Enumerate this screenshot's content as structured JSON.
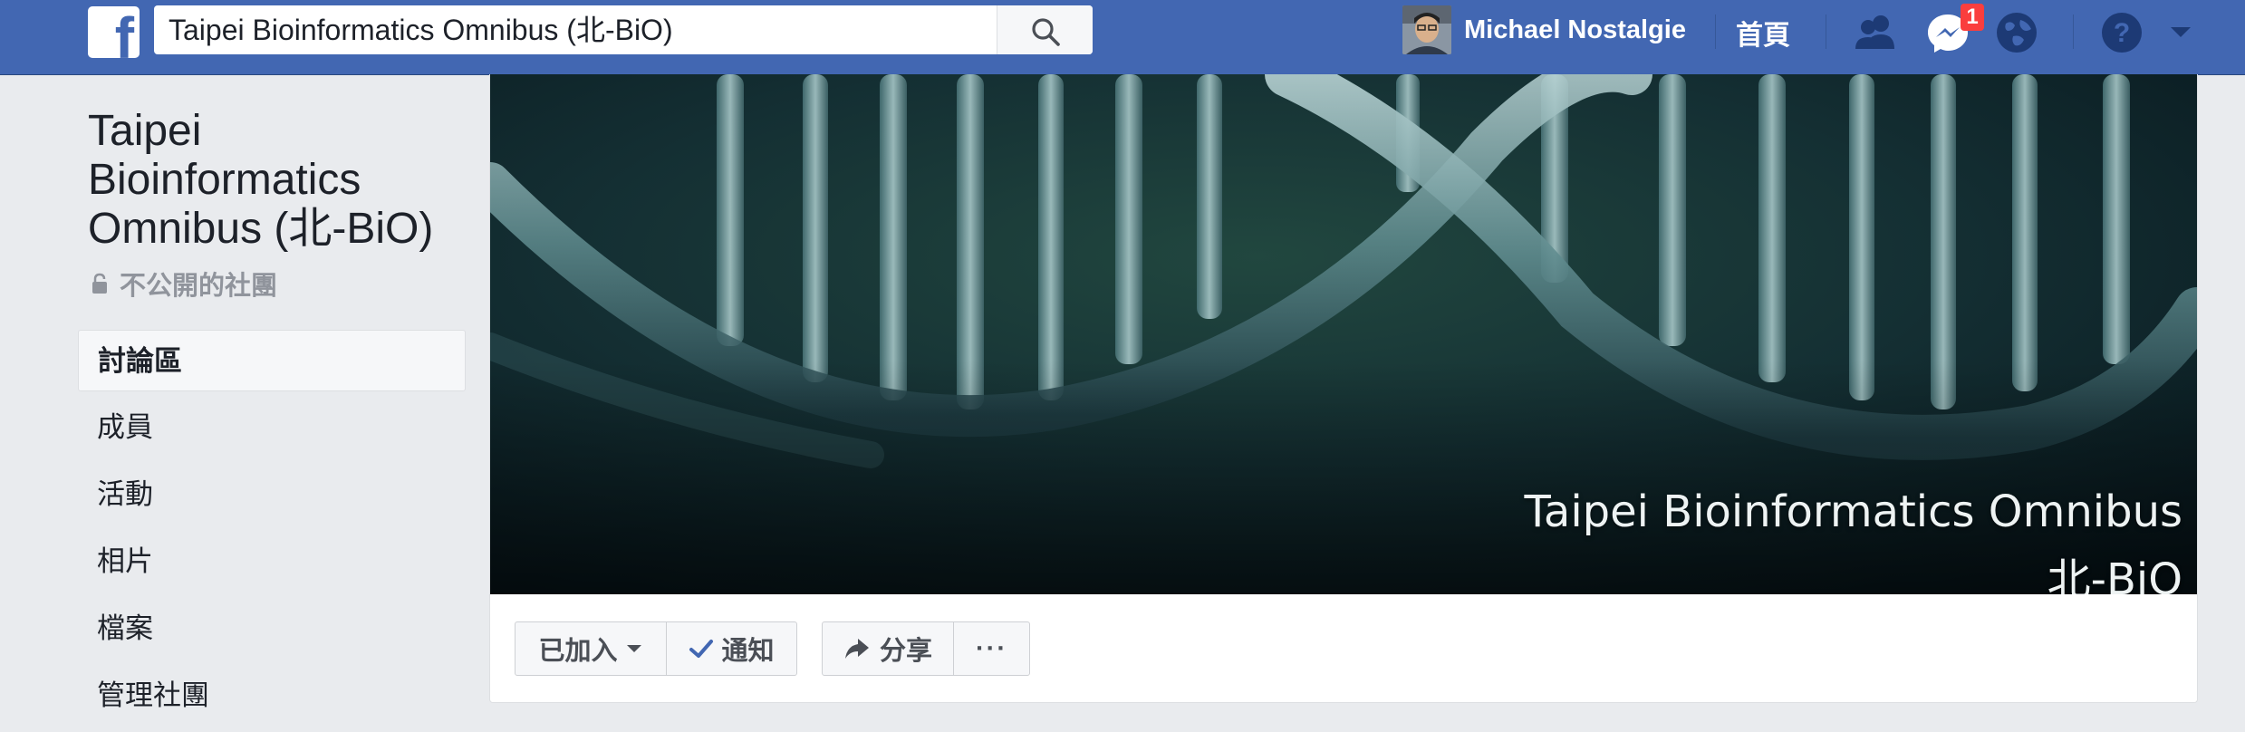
{
  "topbar": {
    "logo_letter": "f",
    "search_value": "Taipei Bioinformatics Omnibus (北-BiO)",
    "profile_name": "Michael Nostalgie",
    "home_label": "首頁",
    "messages_badge": "1",
    "icons": [
      "friend-requests-icon",
      "messenger-icon",
      "notifications-globe-icon",
      "help-icon",
      "account-menu-chevron-icon"
    ],
    "color": "#4267b2"
  },
  "group": {
    "title_lines": [
      "Taipei",
      "Bioinformatics",
      "Omnibus (北-BiO)"
    ],
    "privacy": "不公開的社團"
  },
  "sidebar": {
    "items": [
      {
        "label": "討論區",
        "active": true
      },
      {
        "label": "成員"
      },
      {
        "label": "活動"
      },
      {
        "label": "相片"
      },
      {
        "label": "檔案"
      },
      {
        "label": "管理社團"
      }
    ]
  },
  "cover": {
    "line1": "Taipei Bioinformatics Omnibus",
    "line2": "北-BiO"
  },
  "actions": {
    "joined": "已加入",
    "notify": "通知",
    "share": "分享",
    "more": "···"
  }
}
